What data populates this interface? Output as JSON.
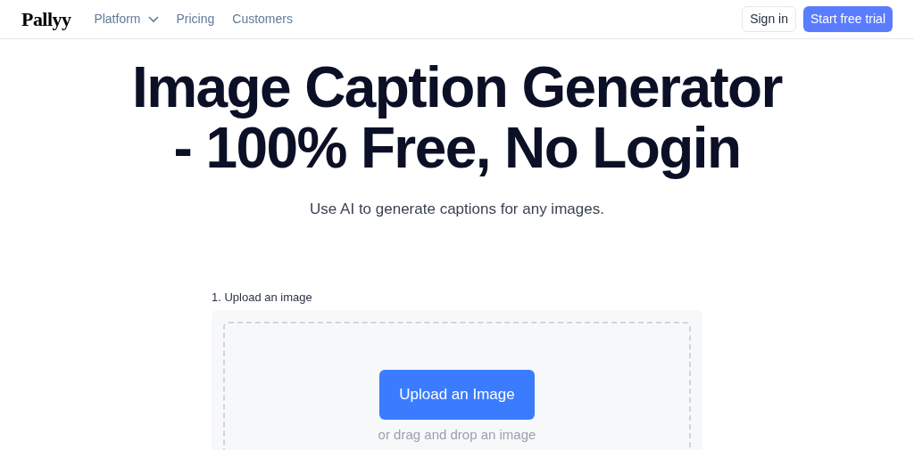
{
  "header": {
    "logo": "Pallyy",
    "nav": [
      {
        "label": "Platform",
        "has_menu": true
      },
      {
        "label": "Pricing",
        "has_menu": false
      },
      {
        "label": "Customers",
        "has_menu": false
      }
    ],
    "sign_in": "Sign in",
    "cta": "Start free trial"
  },
  "hero": {
    "title_lines": [
      "Image Caption Generator",
      "- 100% Free, No Login"
    ],
    "subtitle": "Use AI to generate captions for any images."
  },
  "upload": {
    "label": "1. Upload an image",
    "button": "Upload an Image",
    "hint": "or drag and drop an image"
  }
}
